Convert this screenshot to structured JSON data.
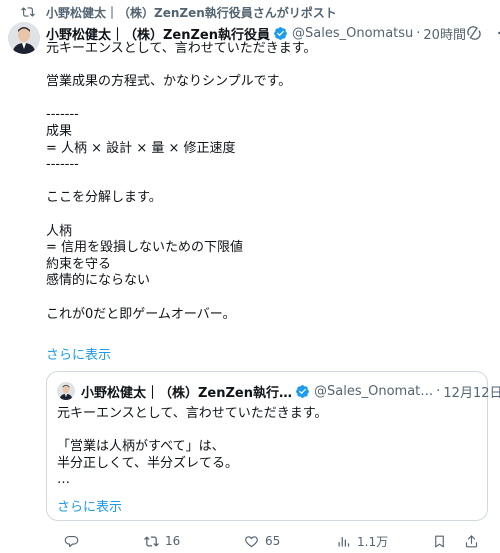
{
  "repost_banner": "小野松健太｜（株）ZenZen執行役員さんがリポスト",
  "post": {
    "author_name": "小野松健太｜（株）ZenZen執行役員",
    "handle": "@Sales_Onomatsu",
    "separator": "·",
    "time": "20時間",
    "text": "元キーエンスとして、言わせていただきます。\n\n営業成果の方程式、かなりシンプルです。\n\n-------\n成果\n= 人柄 × 設計 × 量 × 修正速度\n-------\n\nここを分解します。\n\n人柄\n= 信用を毀損しないための下限値\n約束を守る\n感情的にならない\n\nこれが0だと即ゲームオーバー。",
    "show_more": "さらに表示"
  },
  "quote": {
    "author_name": "小野松健太｜（株）ZenZen執行…",
    "handle": "@Sales_Onomat…",
    "separator": "·",
    "time": "12月12日",
    "text": "元キーエンスとして、言わせていただきます。\n\n「営業は人柄がすべて」は、\n半分正しくて、半分ズレてる。\n…",
    "show_more": "さらに表示"
  },
  "actions": {
    "reply_count": "",
    "retweet_count": "16",
    "like_count": "65",
    "views_count": "1.1万"
  },
  "icons": {
    "retweet": "retweet-icon",
    "verified": "verified-badge-icon",
    "grok": "grok-icon",
    "more": "more-icon",
    "reply": "reply-icon",
    "like": "heart-icon",
    "views": "views-icon",
    "bookmark": "bookmark-icon",
    "share": "share-icon"
  },
  "colors": {
    "accent": "#1d9bf0",
    "secondary_text": "#536471",
    "border": "#cfd9de"
  }
}
